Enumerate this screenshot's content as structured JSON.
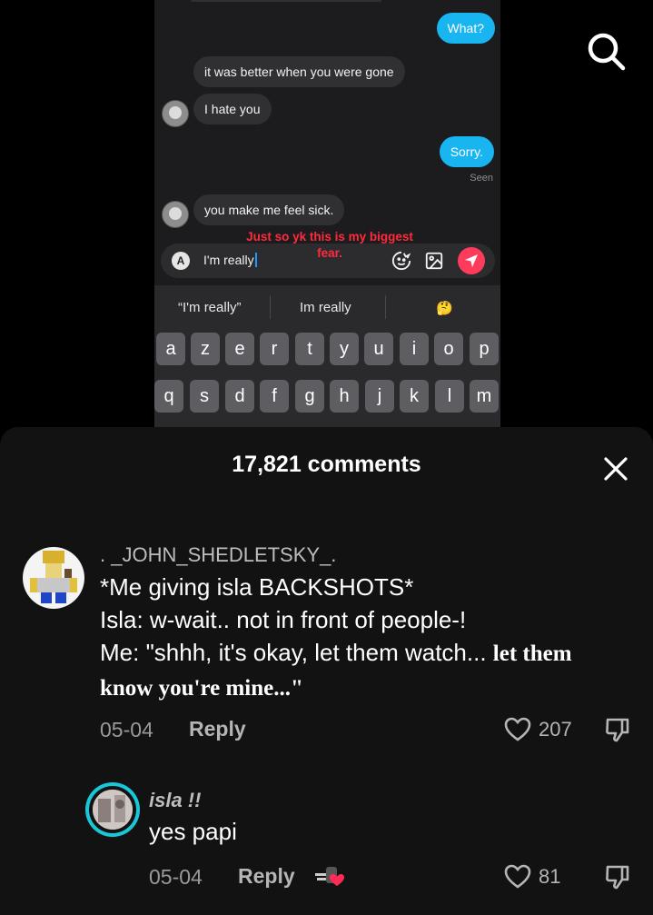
{
  "chat": {
    "msg_out_1": "What?",
    "msg_in_1": "it was better when you were gone",
    "msg_in_2": "I hate you",
    "msg_out_2": "Sorry.",
    "seen": "Seen",
    "msg_in_3": "you make me feel sick.",
    "overlay_caption": "Just so yk this is my biggest fear.",
    "input_badge": "A",
    "input_value": "I'm really",
    "send_color": "#ff3b5c",
    "suggestions": [
      "“I'm really”",
      "Im really",
      "🤔"
    ],
    "keys_row1": [
      "a",
      "z",
      "e",
      "r",
      "t",
      "y",
      "u",
      "i",
      "o",
      "p"
    ],
    "keys_row2": [
      "q",
      "s",
      "d",
      "f",
      "g",
      "h",
      "j",
      "k",
      "l",
      "m"
    ]
  },
  "comments_panel": {
    "title": "17,821 comments",
    "comments": [
      {
        "username": ". _JOHN_SHEDLETSKY_.",
        "line1": "*Me giving isla BACKSHOTS*",
        "line2": "Isla: w-wait.. not in front of people-!",
        "line3_plain": "Me: \"shhh, it's okay, let them watch... ",
        "line3_bold": "let them know you're mine...\"",
        "date": "05-04",
        "reply_label": "Reply",
        "likes": "207"
      },
      {
        "username": "isla !!",
        "text": "yes papi",
        "date": "05-04",
        "reply_label": "Reply",
        "likes": "81"
      }
    ]
  },
  "icons": [
    "search-icon",
    "close-icon",
    "heart-icon",
    "dislike-icon",
    "send-icon",
    "emoji-icon",
    "image-icon"
  ],
  "accent": "#18b5f0"
}
